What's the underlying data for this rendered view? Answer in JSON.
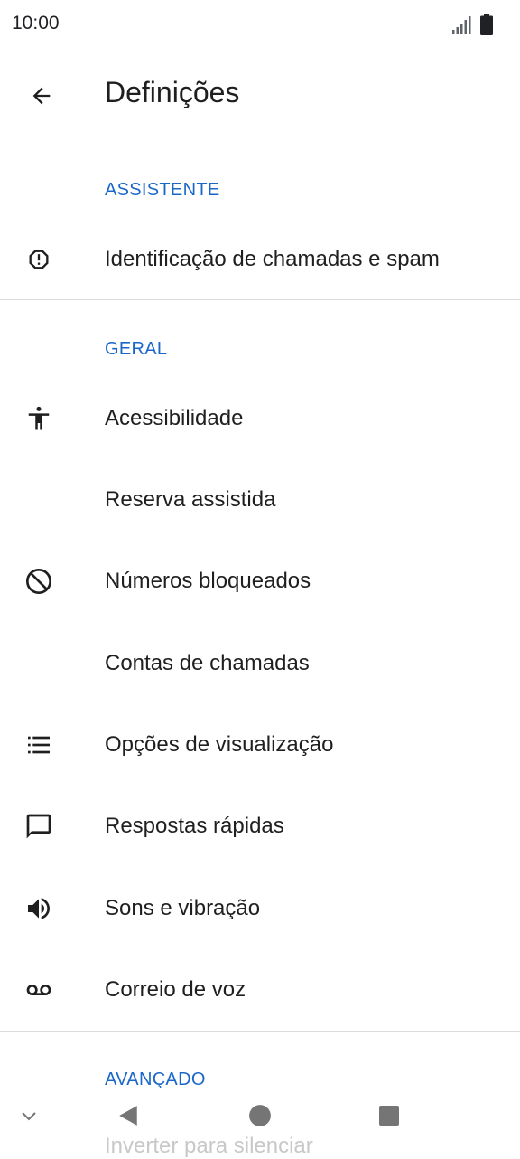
{
  "status_bar": {
    "time": "10:00",
    "icons": [
      "signal-icon",
      "battery-icon"
    ]
  },
  "app_bar": {
    "title": "Definições",
    "back_icon": "arrow-back-icon"
  },
  "sections": {
    "assistant": {
      "header": "ASSISTENTE",
      "items": [
        {
          "label": "Identificação de chamadas e spam",
          "icon": "spam-alert-icon"
        }
      ]
    },
    "general": {
      "header": "GERAL",
      "items": [
        {
          "label": "Acessibilidade",
          "icon": "accessibility-icon"
        },
        {
          "label": "Reserva assistida",
          "icon": ""
        },
        {
          "label": "Números bloqueados",
          "icon": "block-icon"
        },
        {
          "label": "Contas de chamadas",
          "icon": ""
        },
        {
          "label": "Opções de visualização",
          "icon": "list-icon"
        },
        {
          "label": "Respostas rápidas",
          "icon": "message-icon"
        },
        {
          "label": "Sons e vibração",
          "icon": "volume-icon"
        },
        {
          "label": "Correio de voz",
          "icon": "voicemail-icon"
        }
      ]
    },
    "advanced": {
      "header": "AVANÇADO",
      "items": [
        {
          "label": "Inverter para silenciar",
          "icon": ""
        }
      ]
    }
  },
  "nav_bar": {
    "buttons": [
      "collapse-icon",
      "back-triangle-icon",
      "home-circle-icon",
      "recents-square-icon"
    ]
  },
  "colors": {
    "accent": "#1a67c9",
    "text": "#1f1f1f",
    "divider": "#dcdcdc",
    "nav_icon": "#757575"
  }
}
